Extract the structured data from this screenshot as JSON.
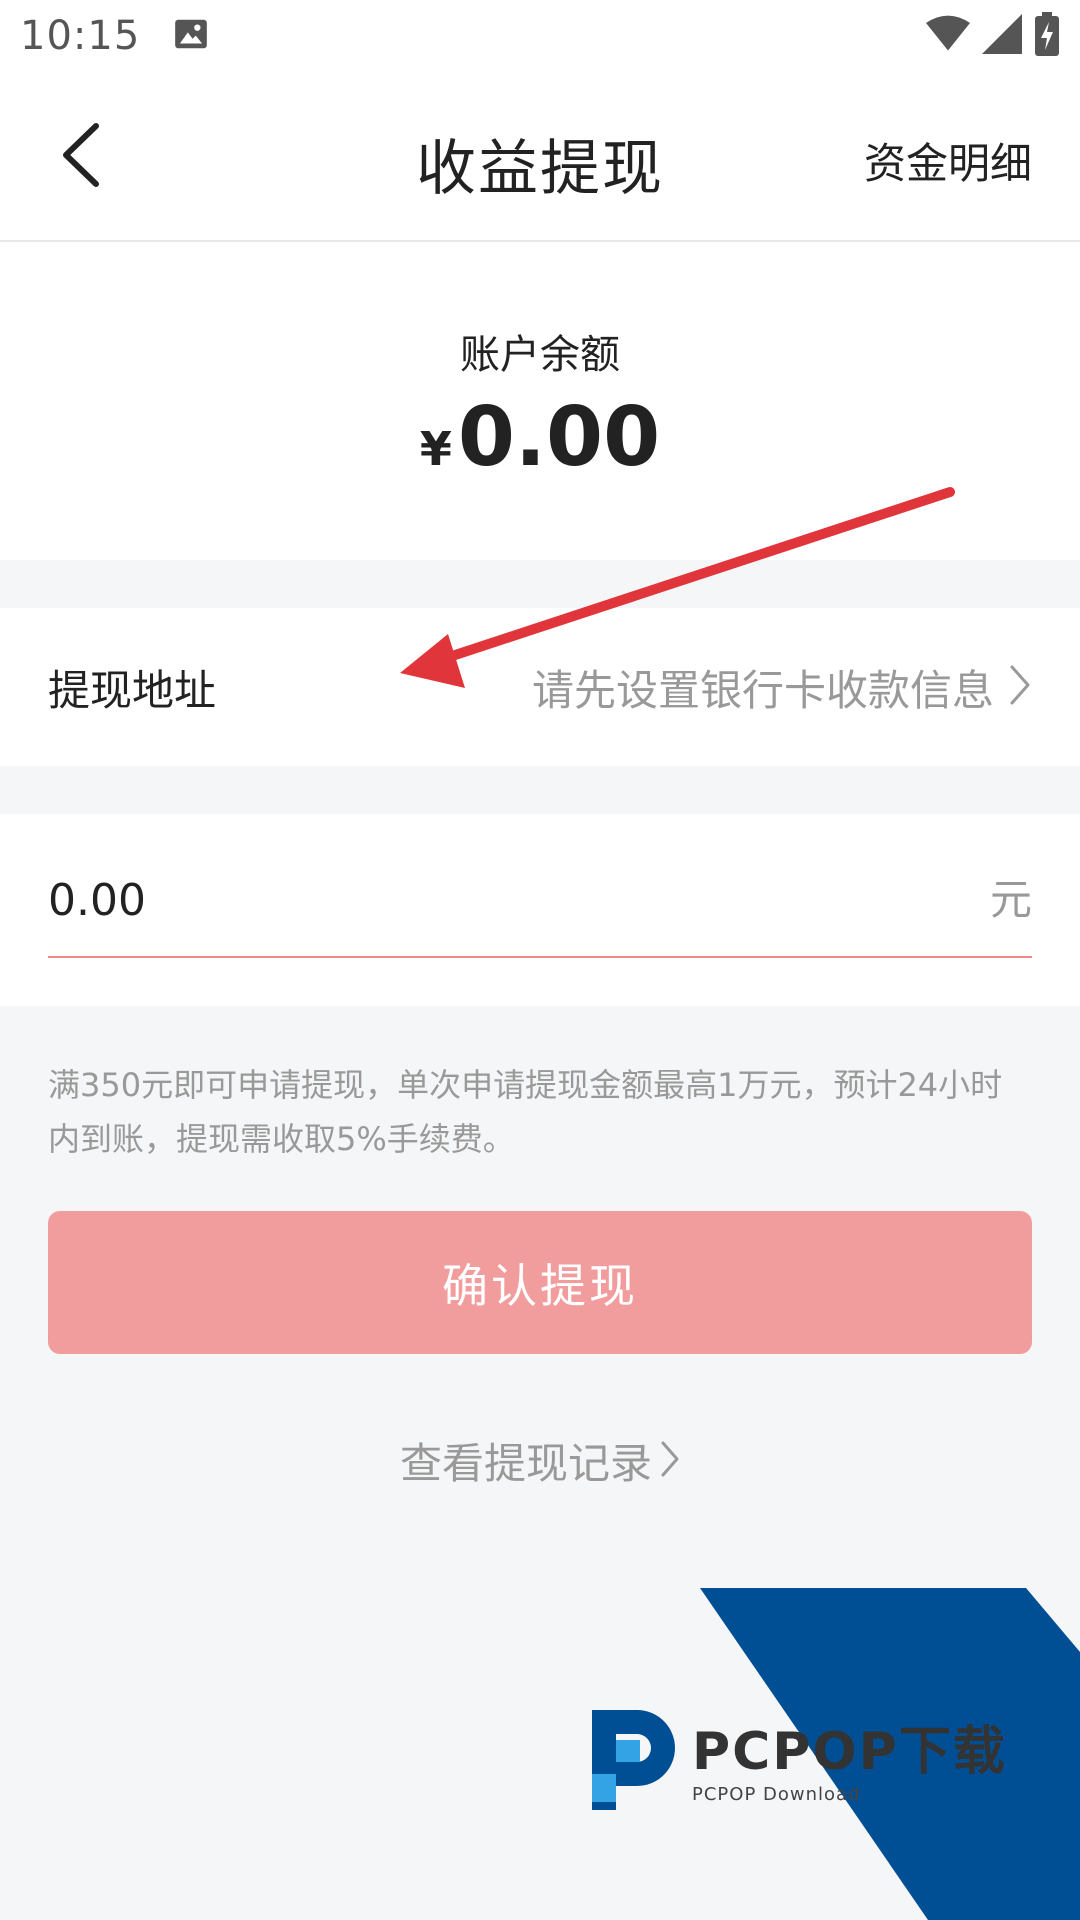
{
  "status_bar": {
    "time": "10:15",
    "icons": [
      "image-icon",
      "wifi-icon",
      "signal-icon",
      "battery-charging-icon"
    ]
  },
  "header": {
    "title": "收益提现",
    "action": "资金明细",
    "back_icon": "chevron-left-icon"
  },
  "balance": {
    "label": "账户余额",
    "currency": "¥",
    "amount": "0.00"
  },
  "address": {
    "label": "提现地址",
    "value": "请先设置银行卡收款信息"
  },
  "amount_field": {
    "value": "0.00",
    "unit": "元"
  },
  "tip": "满350元即可申请提现，单次申请提现金额最高1万元，预计24小时内到账，提现需收取5%手续费。",
  "confirm_button": "确认提现",
  "records_link": "查看提现记录",
  "watermark": {
    "brand": "PCPOP下载",
    "sub": "PCPOP Download"
  },
  "colors": {
    "accent_button": "#f29d9d",
    "input_underline": "#ef8a8a",
    "annotation_arrow": "#e0363b",
    "watermark_blue": "#004f95"
  }
}
